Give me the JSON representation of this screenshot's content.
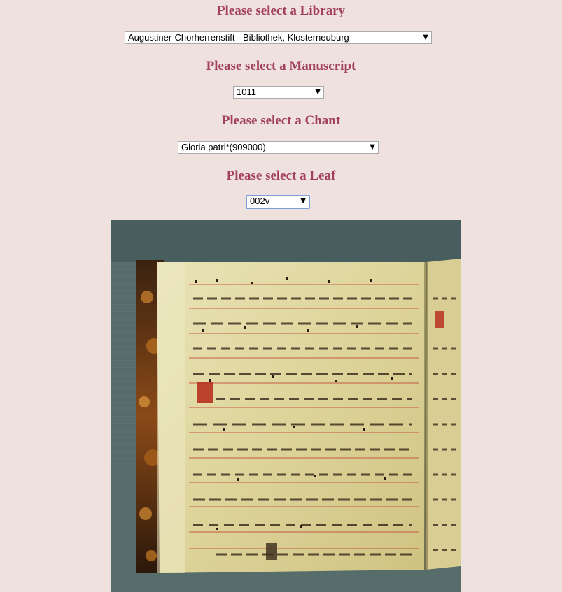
{
  "library": {
    "heading": "Please select a Library",
    "selected": "Augustiner-Chorherrenstift - Bibliothek, Klosterneuburg"
  },
  "manuscript": {
    "heading": "Please select a Manuscript",
    "selected": "1011"
  },
  "chant": {
    "heading": "Please select a Chant",
    "selected": "Gloria patri*(909000)"
  },
  "leaf": {
    "heading": "Please select a Leaf",
    "selected": "002v"
  },
  "colors": {
    "background": "#efe2de",
    "heading": "#a3405e",
    "focus_border": "#7aa0d8"
  },
  "icons": {
    "dropdown": "chevron-down-icon"
  }
}
